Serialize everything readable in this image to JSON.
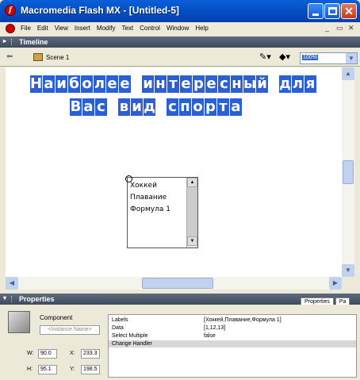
{
  "window": {
    "title": "Macromedia Flash MX - [Untitled-5]",
    "close_glyph": "✕"
  },
  "menu": [
    "File",
    "Edit",
    "View",
    "Insert",
    "Modify",
    "Text",
    "Control",
    "Window",
    "Help"
  ],
  "mdi_controls": [
    "_",
    "▭",
    "✕"
  ],
  "timeline": {
    "label": "Timeline"
  },
  "scene": {
    "label": "Scene 1",
    "zoom": "100%"
  },
  "stage": {
    "heading_lines": [
      [
        "Наиболее",
        "интересный",
        "для"
      ],
      [
        "Вас",
        "вид",
        "спорта"
      ]
    ],
    "list_items": [
      "Хоккей",
      "Плавание",
      "Формула 1"
    ],
    "colors": {
      "heading_bg": "#2a5fd6"
    }
  },
  "properties": {
    "panel_label": "Properties",
    "tabs": [
      "Properties",
      "Pa"
    ],
    "component_label": "Component",
    "instance_placeholder": "<Instance Name>",
    "w": "90.0",
    "h": "95.1",
    "x": "233.3",
    "y": "198.5",
    "rows": [
      {
        "key": "Labels",
        "value": "[Хоккей,Плавание,Формула 1]"
      },
      {
        "key": "Data",
        "value": "[1,12,13]"
      },
      {
        "key": "Select Multiple",
        "value": "false"
      },
      {
        "key": "Change Handler",
        "value": ""
      }
    ]
  }
}
